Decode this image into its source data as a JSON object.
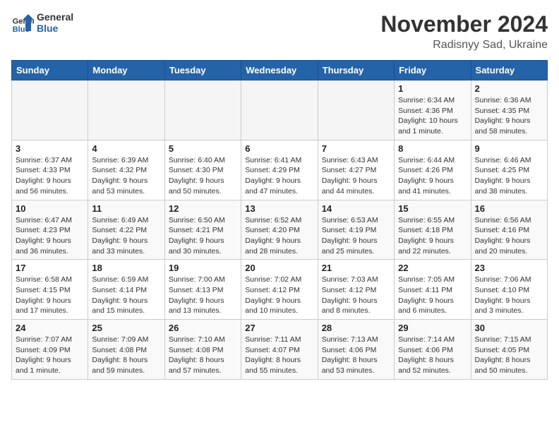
{
  "header": {
    "logo_line1": "General",
    "logo_line2": "Blue",
    "month_title": "November 2024",
    "subtitle": "Radisnyy Sad, Ukraine"
  },
  "weekdays": [
    "Sunday",
    "Monday",
    "Tuesday",
    "Wednesday",
    "Thursday",
    "Friday",
    "Saturday"
  ],
  "weeks": [
    [
      {
        "day": "",
        "info": ""
      },
      {
        "day": "",
        "info": ""
      },
      {
        "day": "",
        "info": ""
      },
      {
        "day": "",
        "info": ""
      },
      {
        "day": "",
        "info": ""
      },
      {
        "day": "1",
        "info": "Sunrise: 6:34 AM\nSunset: 4:36 PM\nDaylight: 10 hours\nand 1 minute."
      },
      {
        "day": "2",
        "info": "Sunrise: 6:36 AM\nSunset: 4:35 PM\nDaylight: 9 hours\nand 58 minutes."
      }
    ],
    [
      {
        "day": "3",
        "info": "Sunrise: 6:37 AM\nSunset: 4:33 PM\nDaylight: 9 hours\nand 56 minutes."
      },
      {
        "day": "4",
        "info": "Sunrise: 6:39 AM\nSunset: 4:32 PM\nDaylight: 9 hours\nand 53 minutes."
      },
      {
        "day": "5",
        "info": "Sunrise: 6:40 AM\nSunset: 4:30 PM\nDaylight: 9 hours\nand 50 minutes."
      },
      {
        "day": "6",
        "info": "Sunrise: 6:41 AM\nSunset: 4:29 PM\nDaylight: 9 hours\nand 47 minutes."
      },
      {
        "day": "7",
        "info": "Sunrise: 6:43 AM\nSunset: 4:27 PM\nDaylight: 9 hours\nand 44 minutes."
      },
      {
        "day": "8",
        "info": "Sunrise: 6:44 AM\nSunset: 4:26 PM\nDaylight: 9 hours\nand 41 minutes."
      },
      {
        "day": "9",
        "info": "Sunrise: 6:46 AM\nSunset: 4:25 PM\nDaylight: 9 hours\nand 38 minutes."
      }
    ],
    [
      {
        "day": "10",
        "info": "Sunrise: 6:47 AM\nSunset: 4:23 PM\nDaylight: 9 hours\nand 36 minutes."
      },
      {
        "day": "11",
        "info": "Sunrise: 6:49 AM\nSunset: 4:22 PM\nDaylight: 9 hours\nand 33 minutes."
      },
      {
        "day": "12",
        "info": "Sunrise: 6:50 AM\nSunset: 4:21 PM\nDaylight: 9 hours\nand 30 minutes."
      },
      {
        "day": "13",
        "info": "Sunrise: 6:52 AM\nSunset: 4:20 PM\nDaylight: 9 hours\nand 28 minutes."
      },
      {
        "day": "14",
        "info": "Sunrise: 6:53 AM\nSunset: 4:19 PM\nDaylight: 9 hours\nand 25 minutes."
      },
      {
        "day": "15",
        "info": "Sunrise: 6:55 AM\nSunset: 4:18 PM\nDaylight: 9 hours\nand 22 minutes."
      },
      {
        "day": "16",
        "info": "Sunrise: 6:56 AM\nSunset: 4:16 PM\nDaylight: 9 hours\nand 20 minutes."
      }
    ],
    [
      {
        "day": "17",
        "info": "Sunrise: 6:58 AM\nSunset: 4:15 PM\nDaylight: 9 hours\nand 17 minutes."
      },
      {
        "day": "18",
        "info": "Sunrise: 6:59 AM\nSunset: 4:14 PM\nDaylight: 9 hours\nand 15 minutes."
      },
      {
        "day": "19",
        "info": "Sunrise: 7:00 AM\nSunset: 4:13 PM\nDaylight: 9 hours\nand 13 minutes."
      },
      {
        "day": "20",
        "info": "Sunrise: 7:02 AM\nSunset: 4:12 PM\nDaylight: 9 hours\nand 10 minutes."
      },
      {
        "day": "21",
        "info": "Sunrise: 7:03 AM\nSunset: 4:12 PM\nDaylight: 9 hours\nand 8 minutes."
      },
      {
        "day": "22",
        "info": "Sunrise: 7:05 AM\nSunset: 4:11 PM\nDaylight: 9 hours\nand 6 minutes."
      },
      {
        "day": "23",
        "info": "Sunrise: 7:06 AM\nSunset: 4:10 PM\nDaylight: 9 hours\nand 3 minutes."
      }
    ],
    [
      {
        "day": "24",
        "info": "Sunrise: 7:07 AM\nSunset: 4:09 PM\nDaylight: 9 hours\nand 1 minute."
      },
      {
        "day": "25",
        "info": "Sunrise: 7:09 AM\nSunset: 4:08 PM\nDaylight: 8 hours\nand 59 minutes."
      },
      {
        "day": "26",
        "info": "Sunrise: 7:10 AM\nSunset: 4:08 PM\nDaylight: 8 hours\nand 57 minutes."
      },
      {
        "day": "27",
        "info": "Sunrise: 7:11 AM\nSunset: 4:07 PM\nDaylight: 8 hours\nand 55 minutes."
      },
      {
        "day": "28",
        "info": "Sunrise: 7:13 AM\nSunset: 4:06 PM\nDaylight: 8 hours\nand 53 minutes."
      },
      {
        "day": "29",
        "info": "Sunrise: 7:14 AM\nSunset: 4:06 PM\nDaylight: 8 hours\nand 52 minutes."
      },
      {
        "day": "30",
        "info": "Sunrise: 7:15 AM\nSunset: 4:05 PM\nDaylight: 8 hours\nand 50 minutes."
      }
    ]
  ]
}
